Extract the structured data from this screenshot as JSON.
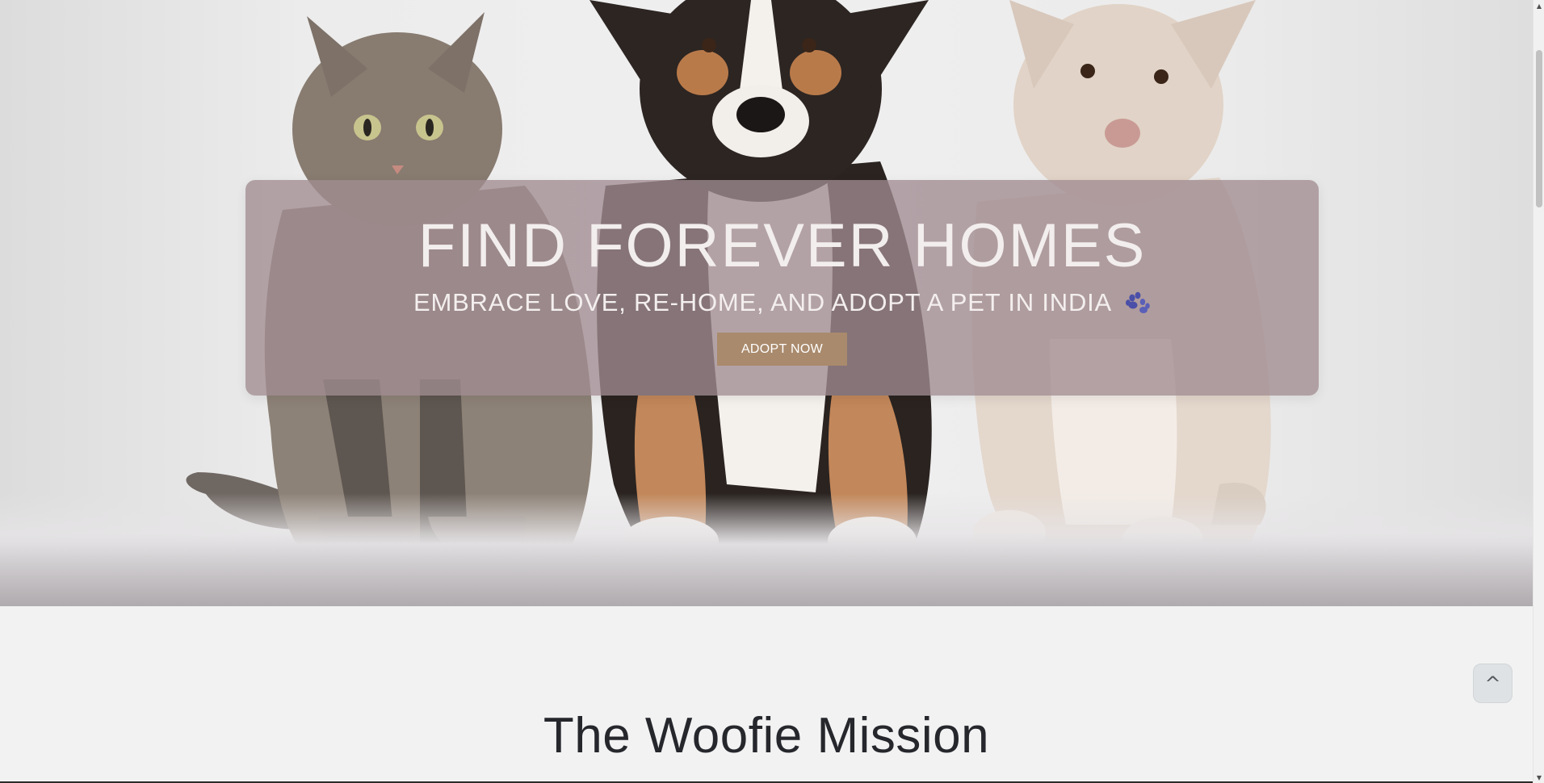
{
  "hero": {
    "title": "FIND FOREVER HOMES",
    "subtitle": "EMBRACE LOVE, RE-HOME, AND ADOPT A PET IN INDIA",
    "subtitle_icon": "paw-icon",
    "cta_label": "ADOPT NOW",
    "image_subjects": [
      "tabby cat",
      "tricolor dog",
      "cream puppy"
    ]
  },
  "mission": {
    "title": "The Woofie Mission"
  },
  "scroll_top": {
    "label": "^"
  },
  "colors": {
    "overlay": "#a08c91",
    "cta": "#a98a6c",
    "heading_text": "#25272c",
    "page_bg": "#f2f2f2",
    "paw_icon": "#4a4fa8"
  }
}
